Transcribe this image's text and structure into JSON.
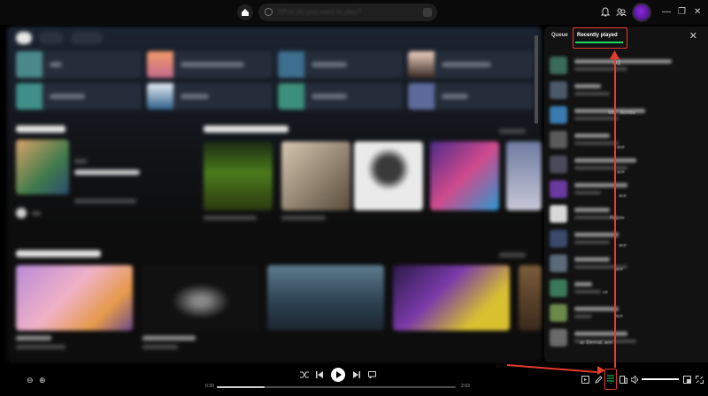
{
  "header": {
    "search_placeholder": "What do you want to play?"
  },
  "right_panel": {
    "tabs": [
      {
        "label": "Queue",
        "active": false
      },
      {
        "label": "Recently played",
        "active": true
      }
    ],
    "close_icon": "close-icon",
    "visible_fragments": [
      "A1",
      "MB",
      "Bombs",
      "ace",
      "ace",
      "ace",
      "Puzzle",
      "ace",
      "ace",
      "ce",
      "ace",
      "ac Eternal, ace"
    ]
  },
  "player": {
    "time_elapsed": "0:30",
    "time_total": "2:03",
    "progress_fraction": 0.2,
    "volume_fraction": 1.0,
    "buttons": [
      "shuffle-icon",
      "previous-icon",
      "play-icon",
      "next-icon",
      "lyrics-icon"
    ],
    "right_buttons": [
      "now-playing-view-icon",
      "pencil-icon",
      "queue-icon",
      "connect-device-icon",
      "volume-icon",
      "miniplayer-icon",
      "fullscreen-icon"
    ]
  },
  "colors": {
    "accent_green": "#1ed767",
    "annotation_red": "#e63b2e",
    "avatar_purple": "#8a2be2"
  }
}
